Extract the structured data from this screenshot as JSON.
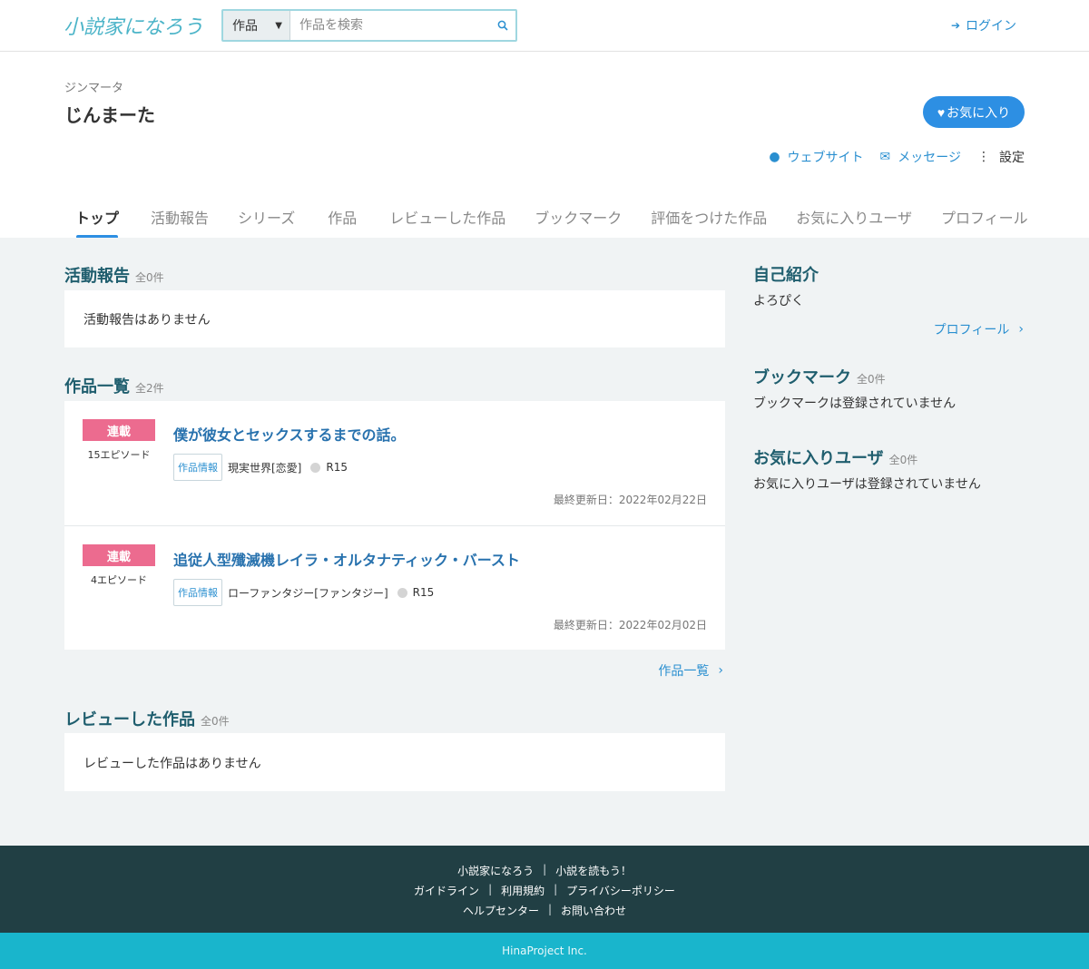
{
  "header": {
    "logo_text": "小説家になろう",
    "search_type": "作品",
    "search_placeholder": "作品を検索",
    "login_label": "ログイン"
  },
  "profile": {
    "kana": "ジンマータ",
    "name": "じんまーた",
    "favorite_label": "お気に入り",
    "website_label": "ウェブサイト",
    "message_label": "メッセージ",
    "settings_label": "設定"
  },
  "tabs": [
    {
      "label": "トップ"
    },
    {
      "label": "活動報告"
    },
    {
      "label": "シリーズ"
    },
    {
      "label": "作品"
    },
    {
      "label": "レビューした作品"
    },
    {
      "label": "ブックマーク"
    },
    {
      "label": "評価をつけた作品"
    },
    {
      "label": "お気に入りユーザ"
    },
    {
      "label": "プロフィール"
    }
  ],
  "activity": {
    "title": "活動報告",
    "count": "全0件",
    "empty": "活動報告はありません"
  },
  "works": {
    "title": "作品一覧",
    "count": "全2件",
    "more_label": "作品一覧",
    "items": [
      {
        "badge": "連載",
        "episodes": "15エピソード",
        "title": "僕が彼女とセックスするまでの話。",
        "info_tag": "作品情報",
        "genre": "現実世界[恋愛]",
        "rating": "R15",
        "updated": "最終更新日：2022年02月22日"
      },
      {
        "badge": "連載",
        "episodes": "4エピソード",
        "title": "追従人型殲滅機レイラ・オルタナティック・バースト",
        "info_tag": "作品情報",
        "genre": "ローファンタジー[ファンタジー]",
        "rating": "R15",
        "updated": "最終更新日：2022年02月02日"
      }
    ]
  },
  "reviews": {
    "title": "レビューした作品",
    "count": "全0件",
    "empty": "レビューした作品はありません"
  },
  "sidebar": {
    "intro_title": "自己紹介",
    "intro_text": "よろぴく",
    "profile_link": "プロフィール",
    "bookmark_title": "ブックマーク",
    "bookmark_count": "全0件",
    "bookmark_empty": "ブックマークは登録されていません",
    "favusers_title": "お気に入りユーザ",
    "favusers_count": "全0件",
    "favusers_empty": "お気に入りユーザは登録されていません"
  },
  "footer": {
    "row1": [
      "小説家になろう",
      "小説を読もう！"
    ],
    "row2": [
      "ガイドライン",
      "利用規約",
      "プライバシーポリシー"
    ],
    "row3": [
      "ヘルプセンター",
      "お問い合わせ"
    ],
    "copyright": "HinaProject Inc."
  },
  "colors": {
    "accent": "#2d8fe3",
    "badge": "#ec6b8f",
    "footer_dark": "#213f44",
    "footer_bar": "#19b5cc"
  }
}
